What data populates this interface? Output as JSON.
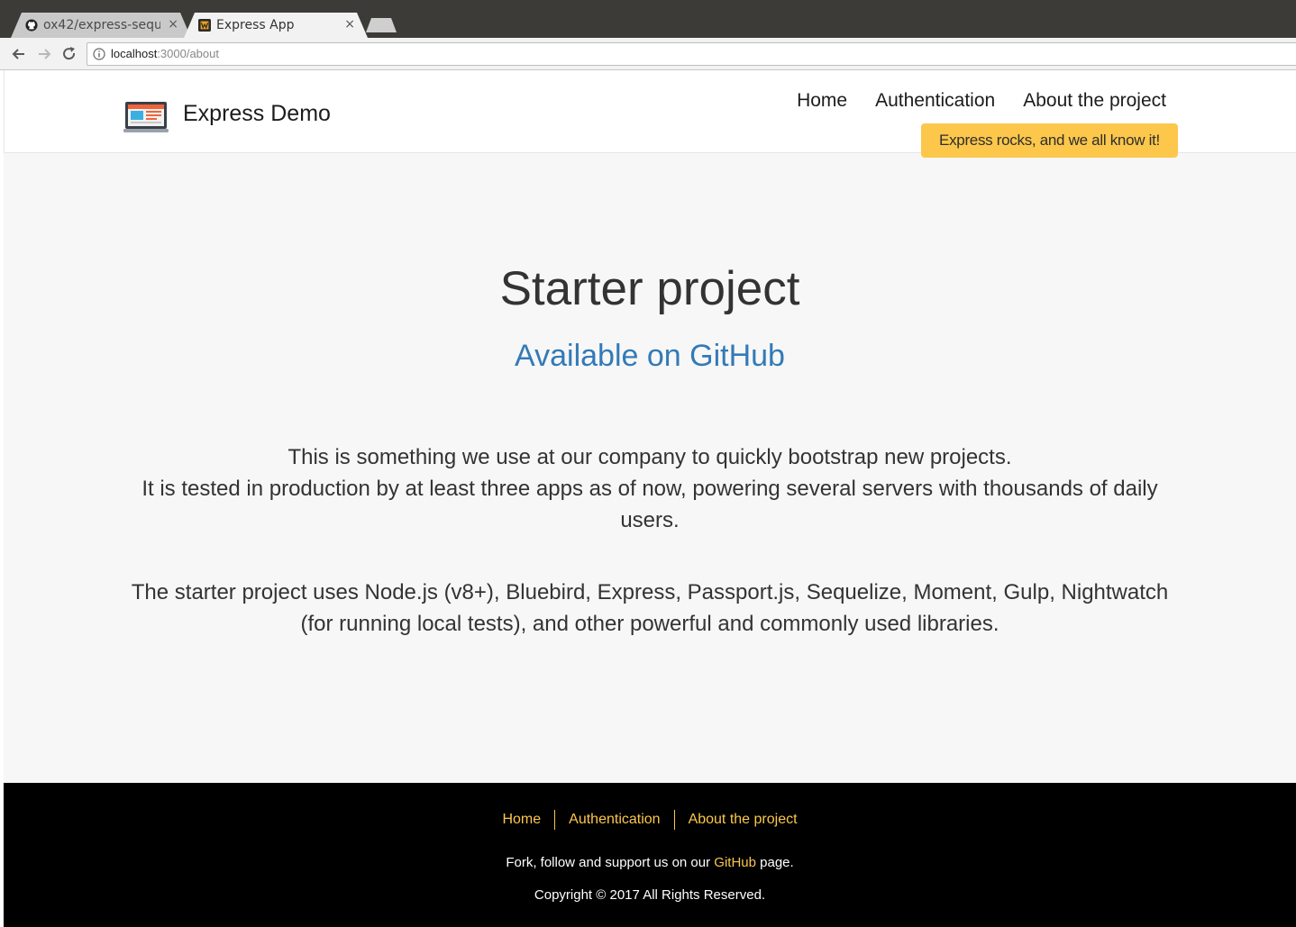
{
  "browser": {
    "tabs": [
      {
        "title": "ox42/express-sequ",
        "favicon": "github-icon",
        "active": false
      },
      {
        "title": "Express App",
        "favicon": "app-favicon-icon",
        "active": true
      }
    ],
    "close_glyph": "×",
    "url": {
      "host": "localhost",
      "rest": ":3000/about"
    }
  },
  "header": {
    "brand": "Express Demo",
    "nav": [
      "Home",
      "Authentication",
      "About the project"
    ],
    "promo": "Express rocks, and we all know it!"
  },
  "main": {
    "title": "Starter project",
    "subtitle": "Available on GitHub",
    "paragraph1_line1": "This is something we use at our company to quickly bootstrap new projects.",
    "paragraph1_line2": "It is tested in production by at least three apps as of now, powering several servers with thousands of daily users.",
    "paragraph2": "The starter project uses Node.js (v8+), Bluebird, Express, Passport.js, Sequelize, Moment, Gulp, Nightwatch (for running local tests), and other powerful and commonly used libraries."
  },
  "footer": {
    "nav": [
      "Home",
      "Authentication",
      "About the project"
    ],
    "support_prefix": "Fork, follow and support us on our ",
    "support_link": "GitHub",
    "support_suffix": " page.",
    "copyright": "Copyright © 2017 All Rights Reserved."
  },
  "colors": {
    "accent": "#fcc74b",
    "link": "#337ab7",
    "footer_bg": "#000000"
  }
}
